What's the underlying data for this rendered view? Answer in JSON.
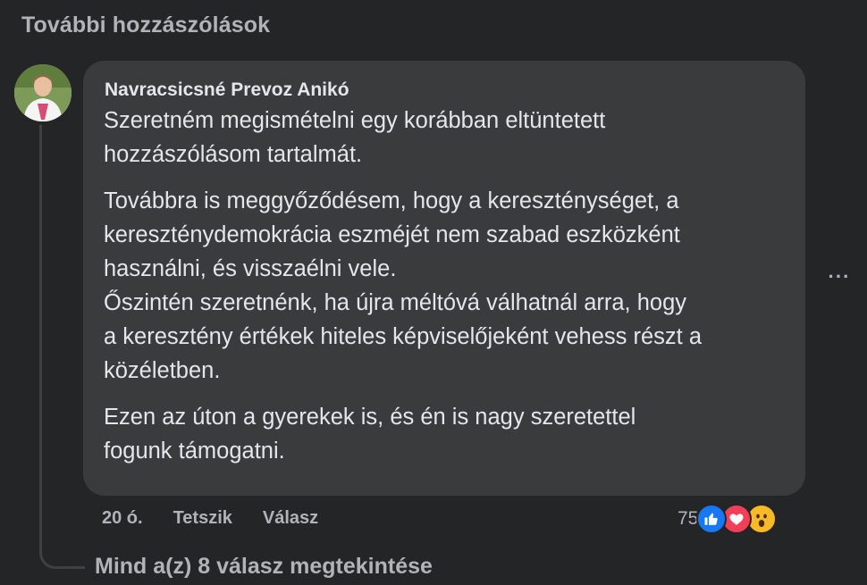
{
  "header": {
    "more_comments_label": "További hozzászólások"
  },
  "comment": {
    "author": "Navracsicsné Prevoz Anikó",
    "paragraphs": [
      [
        "Szeretném megismételni egy korábban eltüntetett",
        "hozzászólásom tartalmát."
      ],
      [
        "Továbbra is meggyőződésem, hogy a kereszténységet, a",
        "kereszténydemokrácia eszméjét nem szabad eszközként",
        "használni, és visszaélni vele.",
        "Őszintén szeretnénk, ha újra méltóvá válhatnál arra, hogy",
        "a keresztény értékek hiteles képviselőjeként vehess részt a",
        "közéletben."
      ],
      [
        "Ezen az úton a gyerekek is, és én is nagy szeretettel",
        "fogunk támogatni."
      ]
    ],
    "more_options_icon": "more-horizontal-icon",
    "more_options_glyph": "···"
  },
  "actions": {
    "time": "20 ó.",
    "like_label": "Tetszik",
    "reply_label": "Válasz"
  },
  "reactions": {
    "count": "75",
    "types": [
      "like",
      "love",
      "wow"
    ],
    "colors": {
      "like": "#1877f2",
      "love": "#f33e58",
      "wow": "#f7b928"
    }
  },
  "replies": {
    "view_label": "Mind a(z) 8 válasz megtekintése"
  },
  "theme": {
    "background": "#242526",
    "bubble": "#3a3b3c",
    "text_primary": "#e4e6eb",
    "text_secondary": "#b0b3b8"
  }
}
